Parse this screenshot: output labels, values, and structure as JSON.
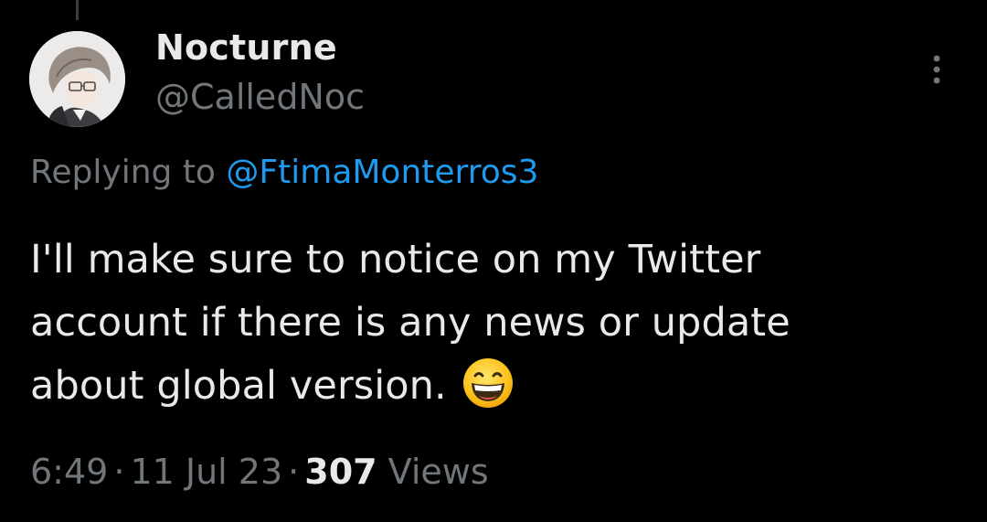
{
  "author": {
    "display_name": "Nocturne",
    "handle": "@CalledNoc"
  },
  "reply": {
    "prefix": "Replying to",
    "mention": "@FtimaMonterros3"
  },
  "body": {
    "lines": [
      "I'll make sure to notice on my Twitter",
      "account if there is any news or update",
      "about global version."
    ],
    "emoji": "grinning-squinting-face"
  },
  "meta": {
    "time": "6:49",
    "separator": "·",
    "date": "11 Jul 23",
    "views_count": "307",
    "views_label": "Views"
  },
  "icons": {
    "more": "more-vertical-icon"
  },
  "colors": {
    "background": "#000000",
    "primary_text": "#e7e9ea",
    "secondary_text": "#71767b",
    "link": "#1d9bf0"
  }
}
